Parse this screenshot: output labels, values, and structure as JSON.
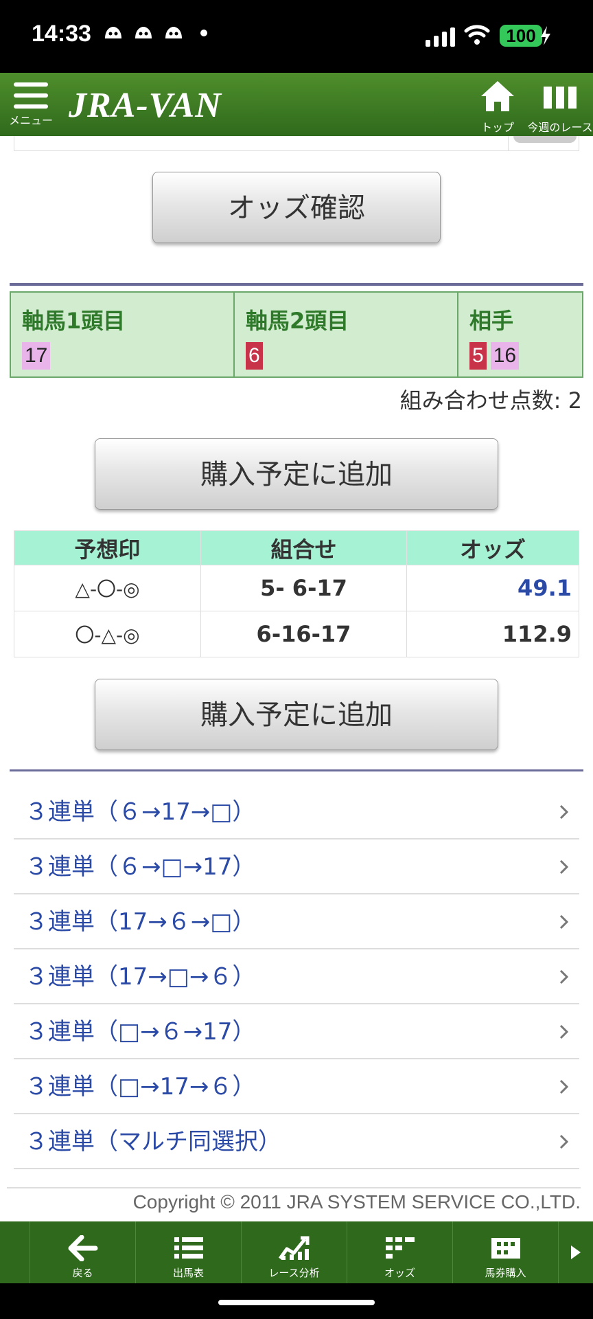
{
  "status": {
    "time": "14:33",
    "battery": "100"
  },
  "header": {
    "menu_label": "メニュー",
    "logo": "JRA-VAN",
    "top_label": "トップ",
    "week_label": "今週のレース"
  },
  "odds_check_button": "オッズ確認",
  "selection": {
    "axis1": {
      "label": "軸馬1頭目",
      "numbers": [
        {
          "value": "17",
          "color": "#e8b4ea"
        }
      ]
    },
    "axis2": {
      "label": "軸馬2頭目",
      "numbers": [
        {
          "value": "6",
          "color": "#c8334a"
        }
      ]
    },
    "partner": {
      "label": "相手",
      "numbers": [
        {
          "value": "5",
          "color": "#c8334a"
        },
        {
          "value": "16",
          "color": "#e8b4ea"
        }
      ]
    }
  },
  "combo_count": "組み合わせ点数: 2",
  "add_button": "購入予定に追加",
  "odds_table": {
    "headers": [
      "予想印",
      "組合せ",
      "オッズ"
    ],
    "rows": [
      {
        "mark": "△-〇-◎",
        "combo": "5- 6-17",
        "odds": "49.1",
        "odds_color": "#2b4aa6"
      },
      {
        "mark": "〇-△-◎",
        "combo": "6-16-17",
        "odds": "112.9",
        "odds_color": "#333333"
      }
    ]
  },
  "links": [
    "３連単（６→17→□）",
    "３連単（６→□→17）",
    "３連単（17→６→□）",
    "３連単（17→□→６）",
    "３連単（□→６→17）",
    "３連単（□→17→６）",
    "３連単（マルチ同選択）"
  ],
  "copyright": "Copyright © 2011 JRA SYSTEM SERVICE CO.,LTD.",
  "bottom_nav": [
    "戻る",
    "出馬表",
    "レース分析",
    "オッズ",
    "馬券購入"
  ],
  "colors": {
    "header_green": "#3a7a22",
    "accent_blue": "#2b4aa6",
    "selection_bg": "#d2ecd0",
    "table_header_bg": "#a6f2d4"
  }
}
